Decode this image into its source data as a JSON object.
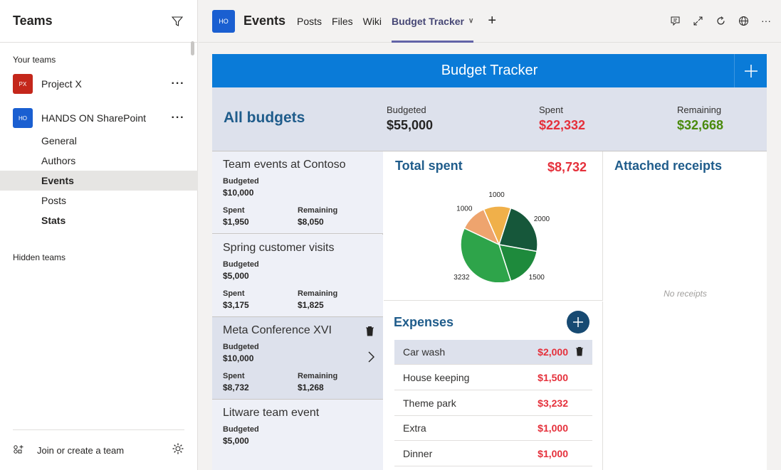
{
  "sidebar": {
    "title": "Teams",
    "your_teams_label": "Your teams",
    "teams": [
      {
        "name": "Project X",
        "initials": "PX",
        "color": "#c4271b"
      },
      {
        "name": "HANDS ON SharePoint",
        "initials": "HO",
        "color": "#1a5fd1"
      }
    ],
    "channels": [
      "General",
      "Authors",
      "Events",
      "Posts",
      "Stats"
    ],
    "hidden_teams_label": "Hidden teams",
    "join_label": "Join or create a team"
  },
  "topbar": {
    "initials": "HO",
    "title": "Events",
    "tabs": [
      "Posts",
      "Files",
      "Wiki",
      "Budget Tracker"
    ]
  },
  "app": {
    "header_title": "Budget Tracker",
    "summary": {
      "title": "All budgets",
      "budgeted_label": "Budgeted",
      "budgeted": "$55,000",
      "spent_label": "Spent",
      "spent": "$22,332",
      "remaining_label": "Remaining",
      "remaining": "$32,668"
    },
    "budgets": [
      {
        "title": "Team events at Contoso",
        "budgeted_label": "Budgeted",
        "budgeted": "$10,000",
        "spent_label": "Spent",
        "spent": "$1,950",
        "remaining_label": "Remaining",
        "remaining": "$8,050"
      },
      {
        "title": "Spring customer visits",
        "budgeted_label": "Budgeted",
        "budgeted": "$5,000",
        "spent_label": "Spent",
        "spent": "$3,175",
        "remaining_label": "Remaining",
        "remaining": "$1,825"
      },
      {
        "title": "Meta Conference XVI",
        "budgeted_label": "Budgeted",
        "budgeted": "$10,000",
        "spent_label": "Spent",
        "spent": "$8,732",
        "remaining_label": "Remaining",
        "remaining": "$1,268"
      },
      {
        "title": "Litware team event",
        "budgeted_label": "Budgeted",
        "budgeted": "$5,000"
      }
    ],
    "total_spent": {
      "title": "Total spent",
      "amount": "$8,732"
    },
    "expenses": {
      "title": "Expenses",
      "items": [
        {
          "name": "Car wash",
          "amount": "$2,000"
        },
        {
          "name": "House keeping",
          "amount": "$1,500"
        },
        {
          "name": "Theme park",
          "amount": "$3,232"
        },
        {
          "name": "Extra",
          "amount": "$1,000"
        },
        {
          "name": "Dinner",
          "amount": "$1,000"
        }
      ]
    },
    "receipts": {
      "title": "Attached receipts",
      "empty_text": "No receipts"
    }
  },
  "chart_data": {
    "type": "pie",
    "values": [
      2000,
      1500,
      3232,
      1000,
      1000
    ],
    "labels": [
      "2000",
      "1500",
      "3232",
      "1000",
      "1000"
    ],
    "colors": [
      "#16573a",
      "#1e8a3c",
      "#2ea44a",
      "#eea46e",
      "#f0b04a"
    ]
  }
}
